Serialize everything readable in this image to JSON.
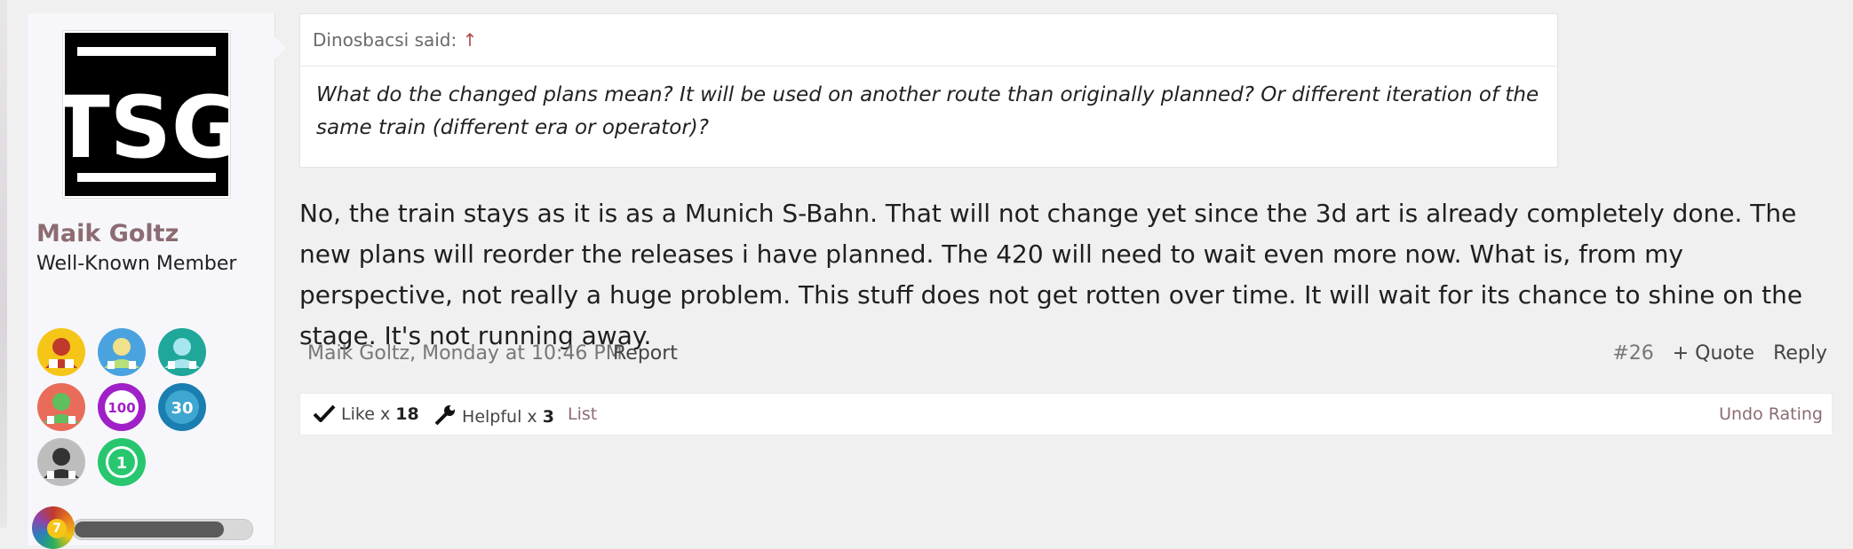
{
  "user": {
    "avatar_text": "TSG",
    "name": "Maik Goltz",
    "title": "Well-Known Member",
    "trophies": [
      "trophy-like-icon",
      "trophy-people-icon",
      "trophy-people-teal-icon",
      "trophy-green-icon",
      "trophy-100-icon",
      "trophy-30-icon",
      "trophy-gray-icon",
      "trophy-1-icon"
    ],
    "trophy_labels": {
      "t100": "100",
      "t30": "30",
      "t1": "1"
    },
    "level": "7",
    "level_progress": 0.85
  },
  "quote": {
    "author_said": "Dinosbacsi said:",
    "jump_arrow": "↑",
    "text": "What do the changed plans mean? It will be used on another route than originally planned? Or different iteration of the same train (different era or operator)?"
  },
  "message": "No, the train stays as it is as a Munich S-Bahn. That will not change yet since the 3d art is already completely done. The new plans will reorder the releases i have planned. The 420 will need to wait even more now. What is, from my perspective, not really a huge problem. This stuff does not get rotten over time. It will wait for its chance to shine on the stage. It's not running away.",
  "footer": {
    "author_date": "Maik Goltz, Monday at 10:46 PM",
    "report": "Report",
    "post_number": "#26",
    "quote": "+ Quote",
    "reply": "Reply"
  },
  "reactions": {
    "like_label": "Like x",
    "like_count": "18",
    "helpful_label": "Helpful x",
    "helpful_count": "3",
    "list": "List",
    "undo": "Undo Rating"
  },
  "colors": {
    "accent": "#8c6c72",
    "background": "#f0f0f0",
    "panel": "#f7f7fb"
  }
}
